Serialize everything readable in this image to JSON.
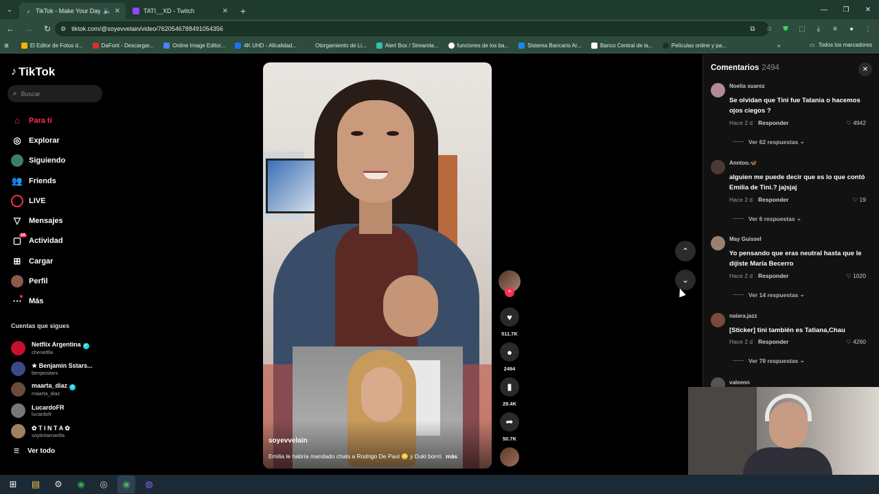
{
  "browser": {
    "tabs": [
      {
        "title": "TikTok - Make Your Day",
        "active": true
      },
      {
        "title": "TATI__XD - Twitch",
        "active": false
      }
    ],
    "url": "tiktok.com/@soyevvelain/video/7620546788491054356",
    "bookmarks": [
      "El Editor de Fotos d...",
      "DaFont - Descargar...",
      "Online Image Editor...",
      "4K UHD - Allcalidad...",
      "Otorgamiento de Li...",
      "Alert Box / Streamla...",
      "funciones de los ba...",
      "Sistema Bancario Ar...",
      "Banco Central de la...",
      "Películas online y pa..."
    ],
    "all_bookmarks": "Todos los marcadores"
  },
  "tiktok": {
    "logo": "TikTok",
    "search_placeholder": "Buscar",
    "nav": [
      {
        "label": "Para ti",
        "icon": "home-icon"
      },
      {
        "label": "Explorar",
        "icon": "compass-icon"
      },
      {
        "label": "Siguiendo",
        "icon": "following-icon"
      },
      {
        "label": "Friends",
        "icon": "friends-icon"
      },
      {
        "label": "LIVE",
        "icon": "live-icon"
      },
      {
        "label": "Mensajes",
        "icon": "message-icon"
      },
      {
        "label": "Actividad",
        "icon": "activity-icon",
        "badge": "16"
      },
      {
        "label": "Cargar",
        "icon": "upload-icon"
      },
      {
        "label": "Perfil",
        "icon": "profile-icon"
      },
      {
        "label": "Más",
        "icon": "more-icon"
      }
    ],
    "following_title": "Cuentas que sigues",
    "following": [
      {
        "name": "Netflix Argentina",
        "handle": "chenetflix",
        "verified": true
      },
      {
        "name": "★ Benjamin Sstars...",
        "handle": "benjasstars",
        "verified": false
      },
      {
        "name": "maarta_diaz",
        "handle": "maarta_diaz",
        "verified": true
      },
      {
        "name": "LucardoFR",
        "handle": "lucardofr",
        "verified": false
      },
      {
        "name": "✿ T I N T A ✿",
        "handle": "soytintamarilla",
        "verified": false
      }
    ],
    "see_all": "Ver todo",
    "video": {
      "author": "soyevvelain",
      "caption": "Emilia le habría mandado chats a Rodrigo De Paul 😳 y Duki borró",
      "more": "más"
    },
    "actions": {
      "likes": "511.7K",
      "comments": "2494",
      "saves": "29.4K",
      "shares": "50.7K"
    },
    "comments_panel": {
      "title": "Comentarios",
      "count": "2494",
      "reply_label": "Responder",
      "items": [
        {
          "user": "Noelia suarez",
          "text": "Se olvidan que Tini fue Tatania o hacemos ojos ciegos ?",
          "time": "Hace 2 d",
          "likes": "4942",
          "replies": "Ver 62 respuestas"
        },
        {
          "user": "Anntoo.🦋",
          "text": "alguien me puede decir que es lo que contó Emilia de Tini.? jajsjaj",
          "time": "Hace 2 d",
          "likes": "19",
          "replies": "Ver 6 respuestas"
        },
        {
          "user": "May Guissel",
          "text": "Yo pensando que eras neutral hasta que le dijiste María Becerro",
          "time": "Hace 2 d",
          "likes": "1020",
          "replies": "Ver 14 respuestas"
        },
        {
          "user": "naiara.jazz",
          "text": "[Sticker] tini también es Tatiana,Chau",
          "time": "Hace 2 d",
          "likes": "4260",
          "replies": "Ver 78 respuestas"
        },
        {
          "user": "valeenn",
          "text": "",
          "time": "",
          "likes": "",
          "replies": ""
        }
      ]
    }
  }
}
